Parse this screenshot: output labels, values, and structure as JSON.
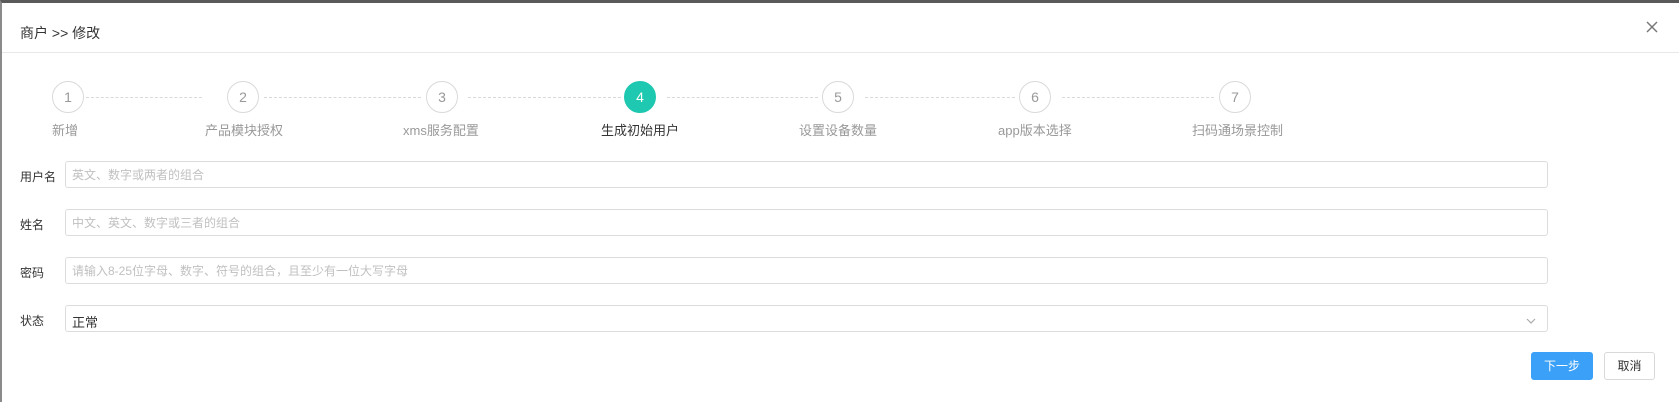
{
  "dialog": {
    "title": "商户 >> 修改",
    "close_icon": "close-icon"
  },
  "steps": [
    {
      "number": "1",
      "label": "新增",
      "active": false
    },
    {
      "number": "2",
      "label": "产品模块授权",
      "active": false
    },
    {
      "number": "3",
      "label": "xms服务配置",
      "active": false
    },
    {
      "number": "4",
      "label": "生成初始用户",
      "active": true
    },
    {
      "number": "5",
      "label": "设置设备数量",
      "active": false
    },
    {
      "number": "6",
      "label": "app版本选择",
      "active": false
    },
    {
      "number": "7",
      "label": "扫码通场景控制",
      "active": false
    }
  ],
  "form": {
    "username": {
      "label": "用户名",
      "value": "",
      "placeholder": "英文、数字或两者的组合"
    },
    "name": {
      "label": "姓名",
      "value": "",
      "placeholder": "中文、英文、数字或三者的组合"
    },
    "password": {
      "label": "密码",
      "value": "",
      "placeholder": "请输入8-25位字母、数字、符号的组合，且至少有一位大写字母"
    },
    "status": {
      "label": "状态",
      "selected": "正常",
      "icon": "chevron-down-icon"
    }
  },
  "actions": {
    "next_label": "下一步",
    "cancel_label": "取消"
  },
  "colors": {
    "active_step": "#1fc8b0",
    "primary_button": "#3ba0f7",
    "border": "#dcdcdc"
  }
}
